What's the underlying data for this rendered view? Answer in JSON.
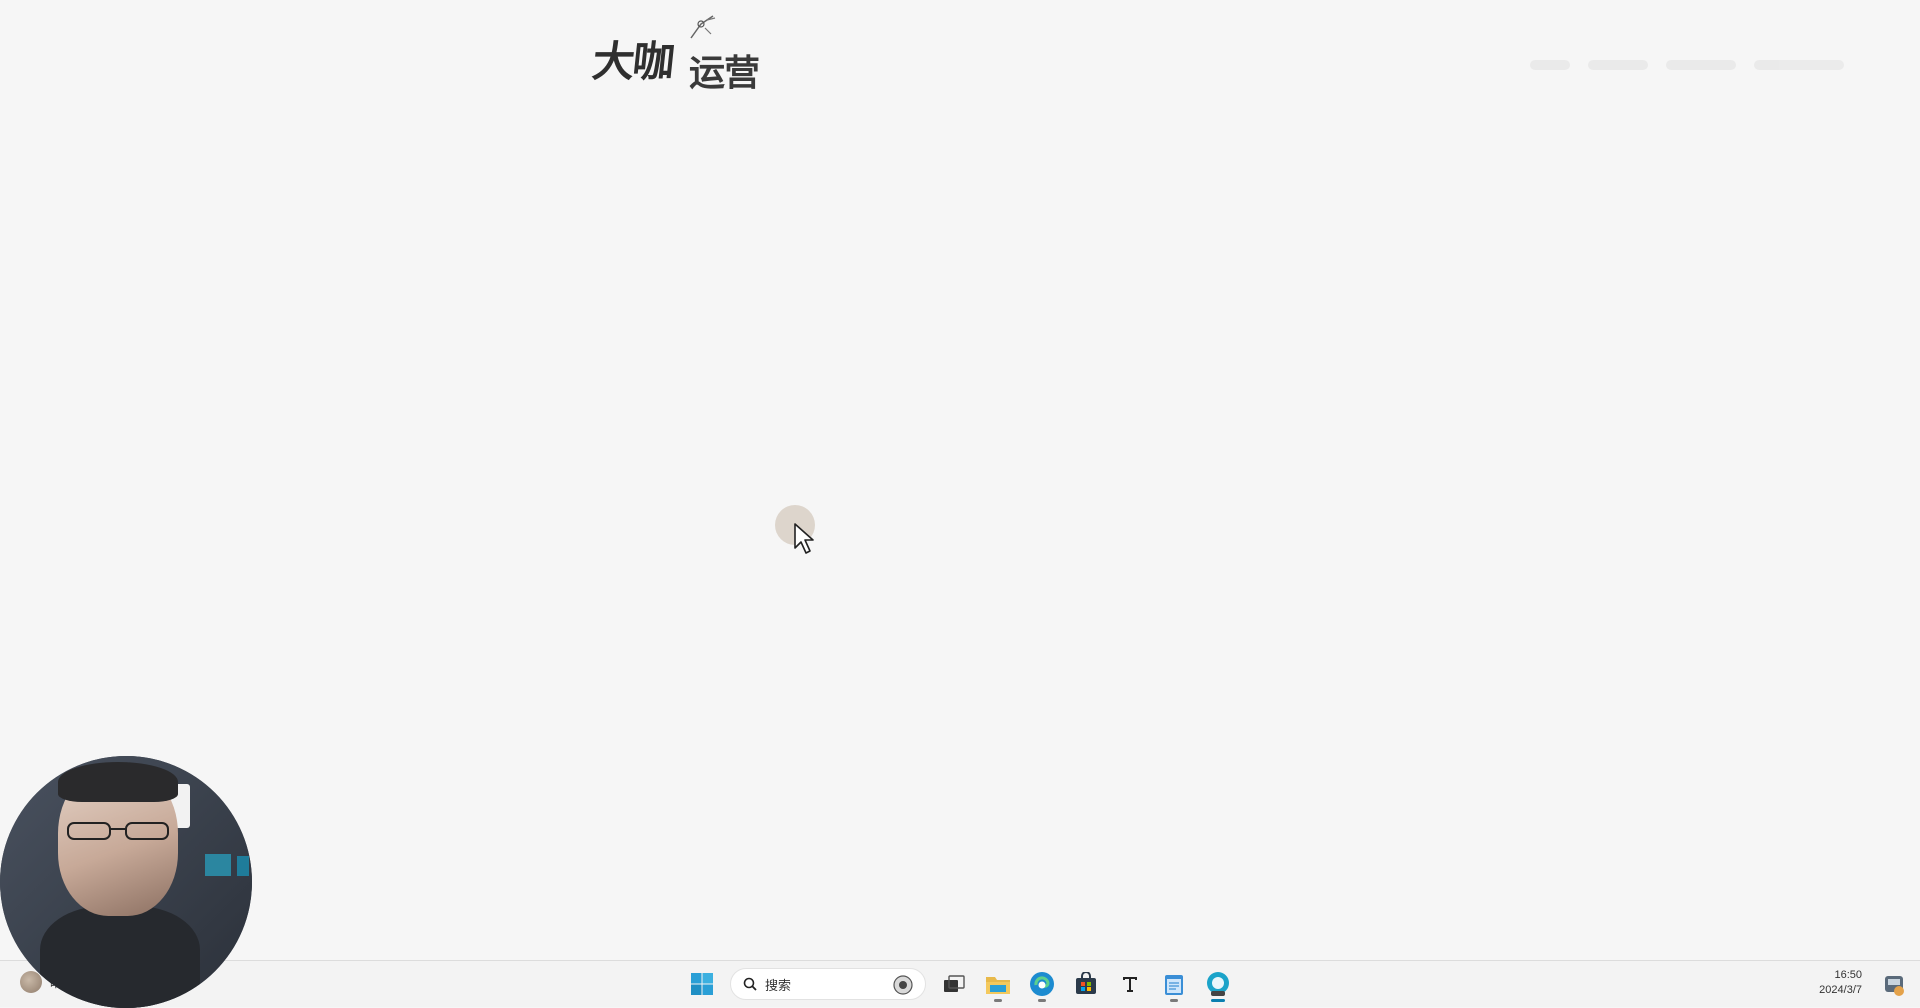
{
  "brand": {
    "line1": "大咖",
    "line2": "运营"
  },
  "taskbar": {
    "weather_label": "晴",
    "search_placeholder": "搜索",
    "time": "16:50",
    "date": "2024/3/7",
    "apps": [
      {
        "name": "start",
        "icon": "windows-icon"
      },
      {
        "name": "task-view",
        "icon": "task-view-icon"
      },
      {
        "name": "file-explorer",
        "icon": "folder-icon"
      },
      {
        "name": "edge",
        "icon": "edge-icon"
      },
      {
        "name": "store",
        "icon": "store-icon"
      },
      {
        "name": "typora",
        "icon": "typora-icon"
      },
      {
        "name": "notepad",
        "icon": "notepad-icon"
      },
      {
        "name": "recorder",
        "icon": "recorder-icon"
      }
    ]
  },
  "colors": {
    "desktop_bg": "#f6f6f6",
    "accent": "#0a7fb0",
    "taskbar_bg": "#f3f3f3"
  }
}
